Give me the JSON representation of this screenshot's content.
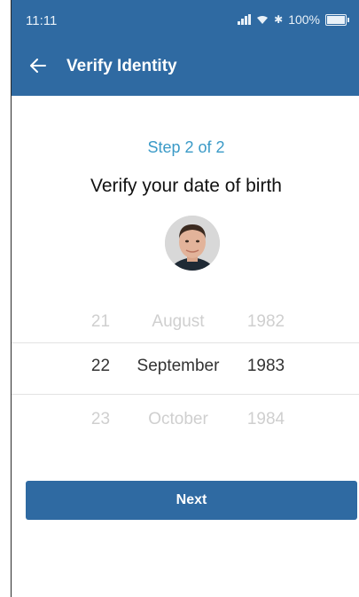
{
  "status_bar": {
    "time": "11:11",
    "bluetooth": "✱",
    "battery_percent": "100%"
  },
  "toolbar": {
    "title": "Verify Identity",
    "back_icon": "arrow-left-icon"
  },
  "content": {
    "step": "Step 2 of 2",
    "heading": "Verify your date of birth"
  },
  "picker": {
    "rows": [
      {
        "day": "21",
        "month": "August",
        "year": "1982"
      },
      {
        "day": "22",
        "month": "September",
        "year": "1983"
      },
      {
        "day": "23",
        "month": "October",
        "year": "1984"
      }
    ],
    "selected_index": 1
  },
  "actions": {
    "next_label": "Next"
  },
  "colors": {
    "primary": "#2f6aa2",
    "step_text": "#3a9ac7",
    "faded_text": "#cfcfcf"
  }
}
